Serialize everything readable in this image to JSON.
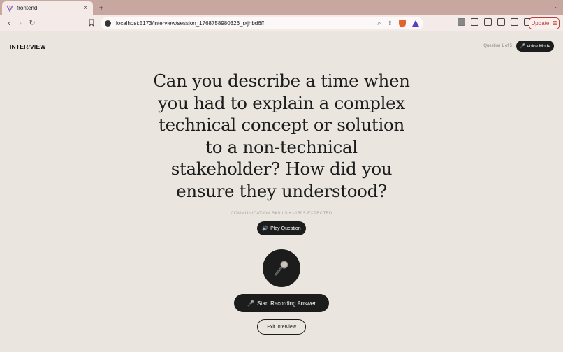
{
  "browser": {
    "tab_title": "frontend",
    "tab_close": "×",
    "new_tab": "+",
    "tab_menu": "⌄",
    "url": "localhost:5173/interview/session_1768758980326_rxjhbd6ff",
    "update_label": "Update",
    "accent_color": "#b4423a"
  },
  "app": {
    "brand": "INTER/VIEW",
    "progress": "Question 1 of 5",
    "voice_mode_label": "Voice Mode",
    "question": "Can you describe a time when you had to explain a complex technical concept or solution to a non-technical stakeholder? How did you ensure they understood?",
    "meta": "COMMUNICATION SKILLS • ~150S EXPECTED",
    "play_label": "Play Question",
    "record_label": "Start Recording Answer",
    "exit_label": "Exit Interview"
  }
}
